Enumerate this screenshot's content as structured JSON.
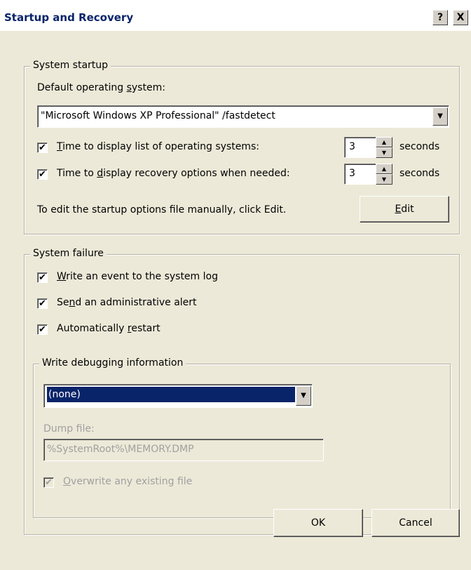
{
  "window": {
    "title": "Startup and Recovery",
    "help_button": "?",
    "close_button": "X"
  },
  "system_startup": {
    "legend": "System startup",
    "default_os_label_prefix": "Default operating ",
    "default_os_label_underlined": "s",
    "default_os_label_suffix": "ystem:",
    "default_os_value": "\"Microsoft Windows XP Professional\" /fastdetect",
    "time_list": {
      "checked": "✔",
      "label_underlined": "T",
      "label_rest": "ime to display list of operating systems:",
      "value": "3",
      "unit": "seconds"
    },
    "time_recovery": {
      "checked": "✔",
      "label_prefix": "Time to ",
      "label_underlined": "d",
      "label_rest": "isplay recovery options when needed:",
      "value": "3",
      "unit": "seconds"
    },
    "edit_hint": "To edit the startup options file manually, click Edit.",
    "edit_button_underlined": "E",
    "edit_button_rest": "dit"
  },
  "system_failure": {
    "legend": "System failure",
    "write_event": {
      "checked": "✔",
      "label_underlined": "W",
      "label_rest": "rite an event to the system log"
    },
    "send_alert": {
      "checked": "✔",
      "label_prefix": "Se",
      "label_underlined": "n",
      "label_rest": "d an administrative alert"
    },
    "auto_restart": {
      "checked": "✔",
      "label_prefix": "Automatically ",
      "label_underlined": "r",
      "label_rest": "estart"
    },
    "debugging": {
      "legend": "Write debugging information",
      "selected_option": "(none)",
      "dump_file_label": "Dump file:",
      "dump_file_value": "%SystemRoot%\\MEMORY.DMP",
      "overwrite": {
        "checked": "✔",
        "label_underlined": "O",
        "label_rest": "verwrite any existing file"
      }
    }
  },
  "buttons": {
    "ok": "OK",
    "cancel": "Cancel"
  },
  "icons": {
    "dropdown": "▼",
    "spin_up": "▲",
    "spin_down": "▼"
  }
}
